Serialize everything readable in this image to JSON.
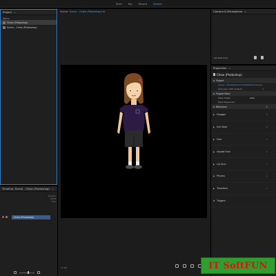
{
  "topbar": {
    "tabs": [
      {
        "label": "Start"
      },
      {
        "label": "Rig"
      },
      {
        "label": "Record"
      },
      {
        "label": "Stream",
        "active": true
      }
    ]
  },
  "project": {
    "title": "Project",
    "column_header": "Name",
    "items": [
      {
        "label": "Chloe (Photoshop)",
        "icon": "puppet-icon",
        "selected": true
      },
      {
        "label": "Scene - Chloe (Photoshop)",
        "icon": "scene-icon",
        "selected": false
      }
    ]
  },
  "scene": {
    "label": "Scene:",
    "name": "Scene - Chloe (Photoshop)",
    "fps": "12 fps"
  },
  "timeline": {
    "title": "Timeline: Scene - Chloe (Photoshop)",
    "meta_lines": [
      "Duration",
      "00:00",
      "0 fps"
    ],
    "track_label": "Chloe (Photoshop)"
  },
  "camera": {
    "title": "Camera & Microphone",
    "rest_pose": "Set Rest Pose"
  },
  "properties": {
    "title": "Properties",
    "puppet_name": "Chloe (Photoshop)",
    "sections": {
      "puppet": "Puppet",
      "puppet_mesh": "Puppet Mesh",
      "behaviors": "Behaviors"
    },
    "puppet_rows": {
      "source": "Users/.../Media/Character/Media/Chloe.psd",
      "auto_sync": "Auto-sync with Artwork"
    },
    "mesh_rows": {
      "shape_label": "Mesh Shape",
      "shape_value": "Auto",
      "expansion_label": "Mesh Expansion"
    },
    "behaviors": [
      {
        "label": "Dragger"
      },
      {
        "label": "Eye Gaze"
      },
      {
        "label": "Face"
      },
      {
        "label": "Handle Fixer"
      },
      {
        "label": "Lip Sync"
      },
      {
        "label": "Physics"
      },
      {
        "label": "Transform"
      },
      {
        "label": "Triggers"
      }
    ]
  },
  "watermark": "IT SoftFUN",
  "colors": {
    "accent": "#4aa3e8",
    "clip": "#3d5d86",
    "shirt": "#2d1a45",
    "watermark_bg": "#2e9e2e",
    "watermark_text": "#d8131a"
  }
}
